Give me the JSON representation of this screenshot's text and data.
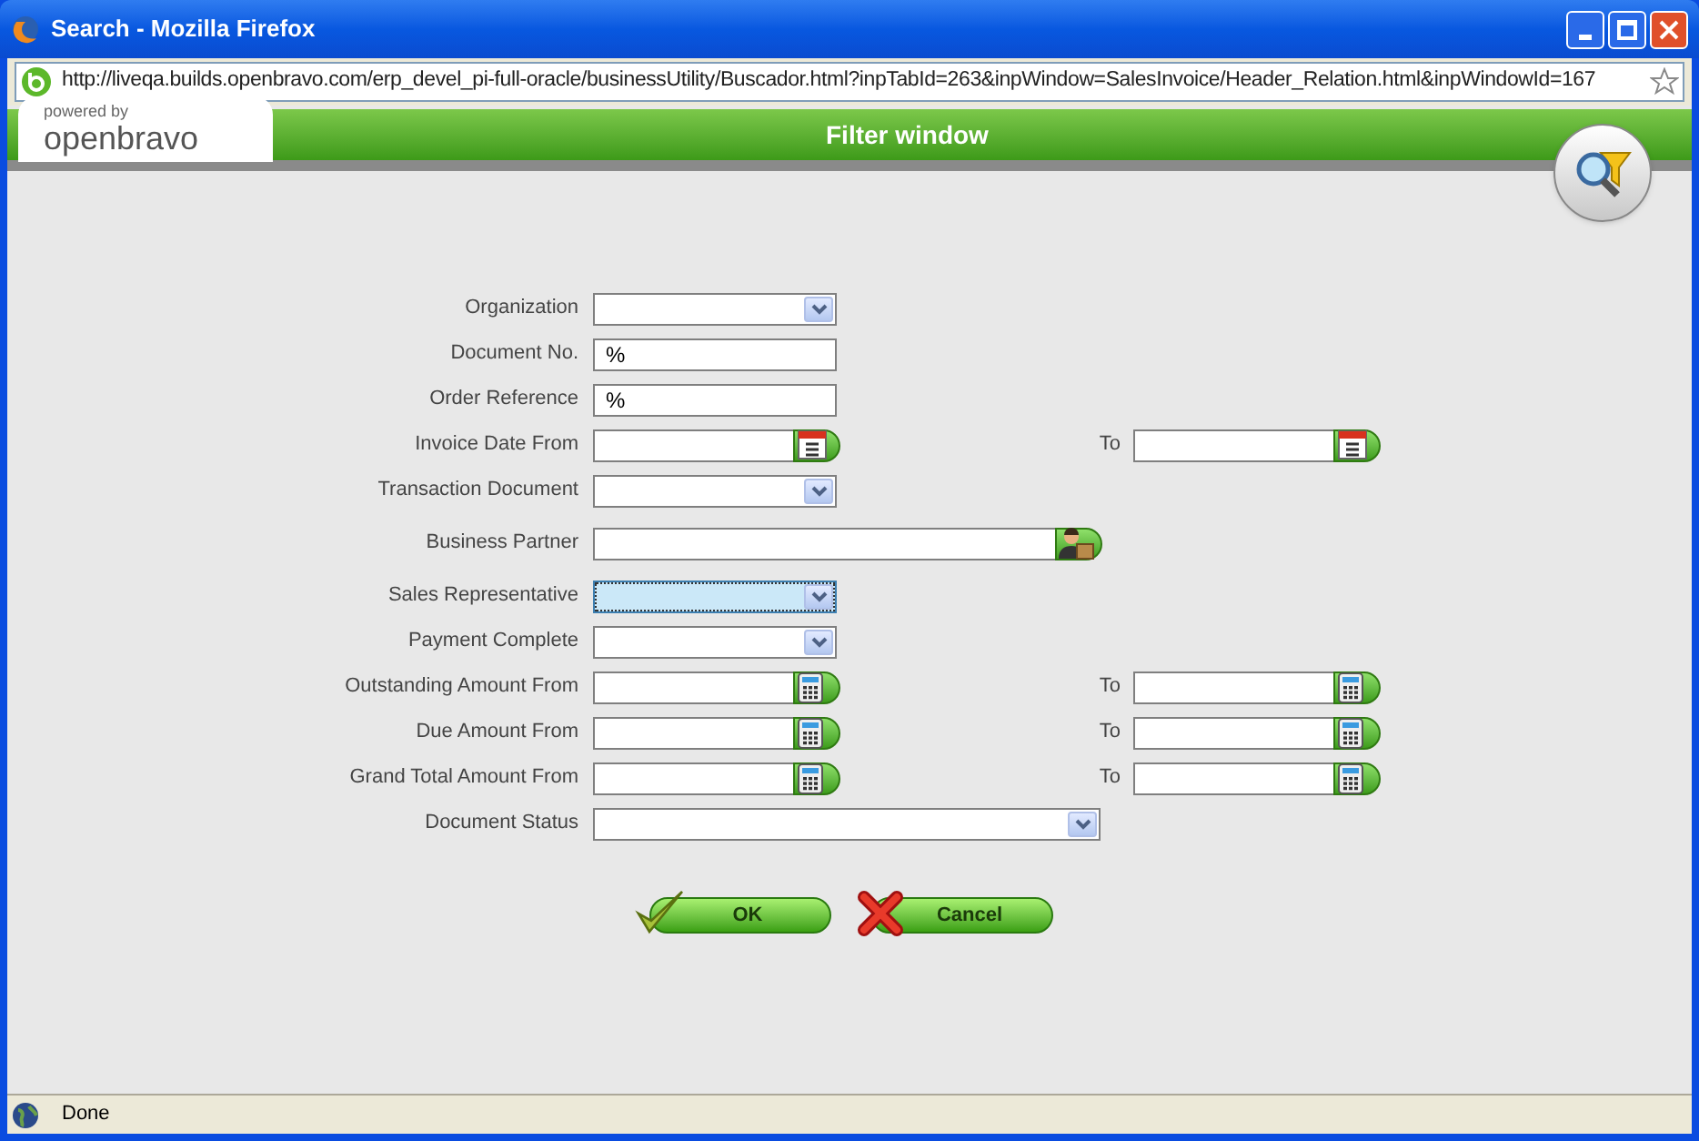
{
  "window": {
    "title": "Search - Mozilla Firefox"
  },
  "address_bar": {
    "url": "http://liveqa.builds.openbravo.com/erp_devel_pi-full-oracle/businessUtility/Buscador.html?inpTabId=263&inpWindow=SalesInvoice/Header_Relation.html&inpWindowId=167"
  },
  "header": {
    "logo_caption": "powered by",
    "logo": "openbravo",
    "title": "Filter window"
  },
  "fields": [
    {
      "kind": "select",
      "label": "Organization",
      "focused": false
    },
    {
      "kind": "text",
      "label": "Document No.",
      "value": "%"
    },
    {
      "kind": "text",
      "label": "Order Reference",
      "value": "%"
    },
    {
      "kind": "date",
      "label": "Invoice Date From",
      "to_label": "To"
    },
    {
      "kind": "select",
      "label": "Transaction Document",
      "focused": false
    },
    {
      "kind": "partner",
      "label": "Business Partner"
    },
    {
      "kind": "select",
      "label": "Sales Representative",
      "focused": true
    },
    {
      "kind": "select",
      "label": "Payment Complete",
      "focused": false
    },
    {
      "kind": "amount",
      "label": "Outstanding Amount From",
      "to_label": "To"
    },
    {
      "kind": "amount",
      "label": "Due Amount From",
      "to_label": "To"
    },
    {
      "kind": "amount",
      "label": "Grand Total Amount From",
      "to_label": "To"
    },
    {
      "kind": "long_select",
      "label": "Document Status",
      "focused": false
    }
  ],
  "buttons": [
    {
      "kind": "ok",
      "label": "OK"
    },
    {
      "kind": "cancel",
      "label": "Cancel"
    }
  ],
  "status_bar": {
    "text": "Done"
  }
}
